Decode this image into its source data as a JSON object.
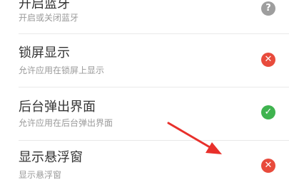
{
  "settings": {
    "items": [
      {
        "title": "开启蓝牙",
        "subtitle": "开启或关闭蓝牙",
        "status": "unknown",
        "status_glyph": "?",
        "status_color": "#9e9e9e"
      },
      {
        "title": "锁屏显示",
        "subtitle": "允许应用在锁屏上显示",
        "status": "denied",
        "status_glyph": "✕",
        "status_color": "#e84b3c"
      },
      {
        "title": "后台弹出界面",
        "subtitle": "允许应用在后台弹出界面",
        "status": "allowed",
        "status_glyph": "✓",
        "status_color": "#3fb34f"
      },
      {
        "title": "显示悬浮窗",
        "subtitle": "显示悬浮窗",
        "status": "denied",
        "status_glyph": "✕",
        "status_color": "#e84b3c"
      }
    ]
  },
  "annotation": {
    "color": "#e8302b"
  }
}
